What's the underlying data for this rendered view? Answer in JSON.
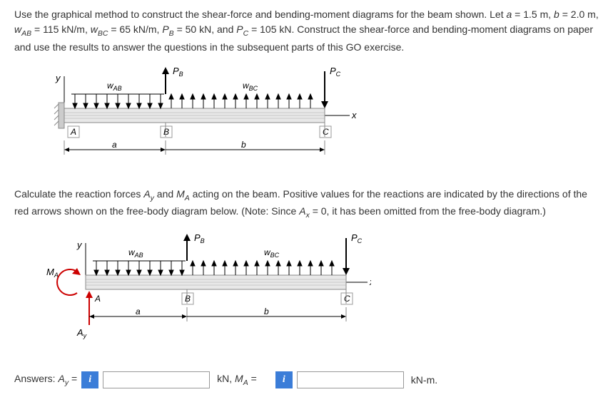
{
  "problem": {
    "text": "Use the graphical method to construct the shear-force and bending-moment diagrams for the beam shown. Let a = 1.5 m, b = 2.0 m, wAB = 115 kN/m, wBC = 65 kN/m, PB = 50 kN, and PC = 105 kN. Construct the shear-force and bending-moment diagrams on paper and use the results to answer the questions in the subsequent parts of this GO exercise."
  },
  "diagram1": {
    "labels": {
      "y": "y",
      "x": "x",
      "wAB": "wAB",
      "wBC": "wBC",
      "PB": "PB",
      "PC": "PC",
      "A": "A",
      "B": "B",
      "C": "C",
      "a": "a",
      "b": "b"
    }
  },
  "instruction": {
    "text": "Calculate the reaction forces Ay and MA acting on the beam. Positive values for the reactions are indicated by the directions of the red arrows shown on the free-body diagram below. (Note: Since Ax = 0, it has been omitted from the free-body diagram.)"
  },
  "diagram2": {
    "labels": {
      "y": "y",
      "x": "x",
      "wAB": "wAB",
      "wBC": "wBC",
      "PB": "PB",
      "PC": "PC",
      "A": "A",
      "B": "B",
      "C": "C",
      "a": "a",
      "b": "b",
      "MA": "MA",
      "Ay": "Ay"
    }
  },
  "answers": {
    "prefix": "Answers:",
    "ay_label": "Ay =",
    "ay_value": "",
    "unit1": "kN,",
    "ma_label": "MA =",
    "ma_value": "",
    "unit2": "kN-m."
  }
}
